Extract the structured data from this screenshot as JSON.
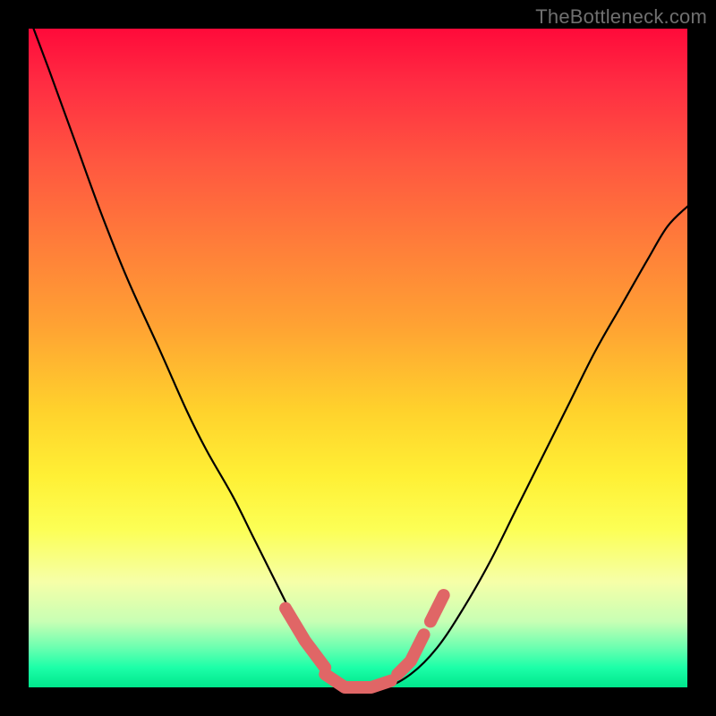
{
  "watermark": "TheBottleneck.com",
  "colors": {
    "frame": "#000000",
    "gradient_top": "#ff0a3a",
    "gradient_bottom": "#00e68c",
    "curve": "#000000",
    "marker": "#e06666"
  },
  "chart_data": {
    "type": "line",
    "title": "",
    "xlabel": "",
    "ylabel": "",
    "xlim": [
      0,
      100
    ],
    "ylim": [
      0,
      100
    ],
    "x": [
      0,
      3,
      7,
      11,
      15,
      20,
      24,
      27,
      31,
      34,
      37,
      40,
      42,
      45,
      47,
      50,
      54,
      58,
      62,
      66,
      70,
      74,
      78,
      82,
      86,
      90,
      94,
      97,
      100
    ],
    "values": [
      102,
      94,
      83,
      72,
      62,
      51,
      42,
      36,
      29,
      23,
      17,
      11,
      7,
      3,
      1,
      0,
      0,
      2,
      6,
      12,
      19,
      27,
      35,
      43,
      51,
      58,
      65,
      70,
      73
    ],
    "marker_segments": [
      {
        "x": [
          39,
          42,
          45
        ],
        "values": [
          12,
          7,
          3
        ]
      },
      {
        "x": [
          45,
          48,
          52,
          55
        ],
        "values": [
          2,
          0,
          0,
          1
        ]
      },
      {
        "x": [
          56,
          58,
          60
        ],
        "values": [
          2,
          4,
          8
        ]
      },
      {
        "x": [
          61,
          63
        ],
        "values": [
          10,
          14
        ]
      }
    ],
    "notes": "Axes have no visible tick labels; x/y are normalized 0–100 across the plot area. Values read from curve geometry relative to plot box."
  }
}
